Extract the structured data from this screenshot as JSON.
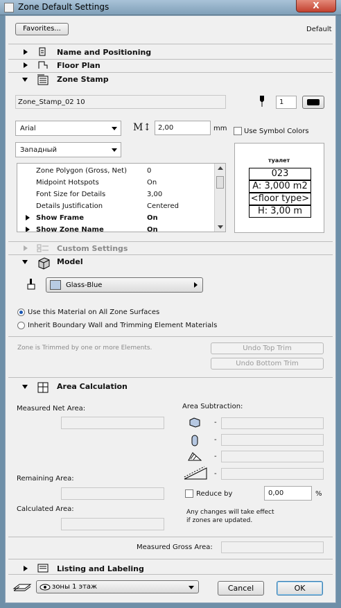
{
  "window": {
    "title": "Zone Default Settings",
    "close_glyph": "X"
  },
  "top": {
    "favorites_label": "Favorites...",
    "default_label": "Default"
  },
  "sections": {
    "name_positioning": "Name and Positioning",
    "floor_plan": "Floor Plan",
    "zone_stamp": "Zone Stamp",
    "custom_settings": "Custom Settings",
    "model": "Model",
    "area_calculation": "Area Calculation",
    "listing_labeling": "Listing and Labeling"
  },
  "zone_stamp": {
    "stamp_name": "Zone_Stamp_02 10",
    "pen_number": "1",
    "font": "Arial",
    "font_size": "2,00",
    "font_size_unit": "mm",
    "script": "Западный",
    "use_symbol_colors": "Use Symbol Colors",
    "params": [
      {
        "k": "Zone Polygon (Gross, Net)",
        "v": "0",
        "bold": false,
        "arrow": false
      },
      {
        "k": "Midpoint Hotspots",
        "v": "On",
        "bold": false,
        "arrow": false
      },
      {
        "k": "Font Size for Details",
        "v": "3,00",
        "bold": false,
        "arrow": false
      },
      {
        "k": "Details Justification",
        "v": "Centered",
        "bold": false,
        "arrow": false
      },
      {
        "k": "Show Frame",
        "v": "On",
        "bold": true,
        "arrow": true
      },
      {
        "k": "Show Zone Name",
        "v": "On",
        "bold": true,
        "arrow": true
      }
    ],
    "preview": {
      "name": "туалет",
      "number": "023",
      "area": "A: 3,000 m2",
      "floor": "<floor type>",
      "height": "H: 3,00 m"
    }
  },
  "model": {
    "material": "Glass-Blue",
    "material_color": "#b7cbe3",
    "radio_all": "Use this Material on All Zone Surfaces",
    "radio_inherit": "Inherit Boundary Wall and Trimming Element Materials",
    "trimmed_note": "Zone is Trimmed by one or more Elements.",
    "undo_top": "Undo Top Trim",
    "undo_bottom": "Undo Bottom Trim"
  },
  "area": {
    "measured_net": "Measured Net Area:",
    "area_subtraction": "Area Subtraction:",
    "remaining": "Remaining Area:",
    "calculated": "Calculated Area:",
    "reduce_by": "Reduce by",
    "reduce_value": "0,00",
    "percent": "%",
    "note_line1": "Any changes will take effect",
    "note_line2": "if zones are updated.",
    "measured_gross": "Measured Gross Area:",
    "dash": "-"
  },
  "bottom": {
    "layer": "зоны 1 этаж",
    "cancel": "Cancel",
    "ok": "OK"
  }
}
